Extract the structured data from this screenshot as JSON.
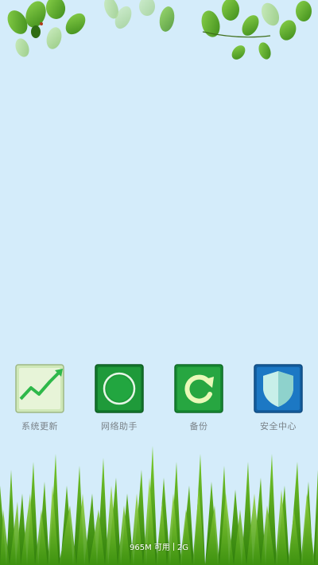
{
  "apps": [
    {
      "label": "系统更新",
      "icon": "chart-trend-icon",
      "color": "#cfe8b8"
    },
    {
      "label": "网络助手",
      "icon": "network-ring-icon",
      "color": "#1f9a3a"
    },
    {
      "label": "备份",
      "icon": "refresh-arrow-icon",
      "color": "#27a641"
    },
    {
      "label": "安全中心",
      "icon": "shield-icon",
      "color": "#1c78c4"
    }
  ],
  "status": {
    "memory": "965M 可用",
    "network": "2G"
  },
  "colors": {
    "background": "#d4ecfa",
    "leaf": "#5fae2a",
    "grass": "#63b81e"
  }
}
